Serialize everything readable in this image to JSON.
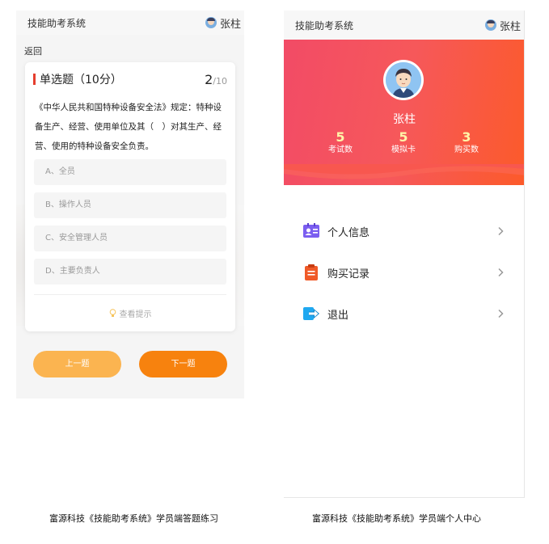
{
  "left": {
    "header": {
      "title": "技能助考系统",
      "user": "张柱"
    },
    "back": "返回",
    "question": {
      "type": "单选题",
      "score": "（10分）",
      "current": "2",
      "total": "/10",
      "text": "《中华人民共和国特种设备安全法》规定：特种设备生产、经营、使用单位及其（　）对其生产、经营、使用的特种设备安全负责。",
      "options": [
        "A、全员",
        "B、操作人员",
        "C、安全管理人员",
        "D、主要负责人"
      ],
      "hint": "查看提示"
    },
    "buttons": {
      "prev": "上一题",
      "next": "下一题"
    },
    "caption": "富源科技《技能助考系统》学员端答题练习"
  },
  "right": {
    "header": {
      "title": "技能助考系统",
      "user": "张柱"
    },
    "profile": {
      "name": "张柱",
      "stats": [
        {
          "value": "5",
          "label": "考试数"
        },
        {
          "value": "5",
          "label": "模拟卡"
        },
        {
          "value": "3",
          "label": "购买数"
        }
      ]
    },
    "menu": [
      {
        "label": "个人信息",
        "icon": "id-card-icon",
        "color": "#7b5ef0"
      },
      {
        "label": "购买记录",
        "icon": "clipboard-icon",
        "color": "#f05a28"
      },
      {
        "label": "退出",
        "icon": "logout-icon",
        "color": "#1fa8f0"
      }
    ],
    "caption": "富源科技《技能助考系统》学员端个人中心"
  },
  "colors": {
    "accent_orange": "#f7820e",
    "accent_light_orange": "#fbb450",
    "profile_gradient_start": "#f24b66",
    "profile_gradient_end": "#fc5a2a",
    "question_bar": "#e53e2e"
  }
}
